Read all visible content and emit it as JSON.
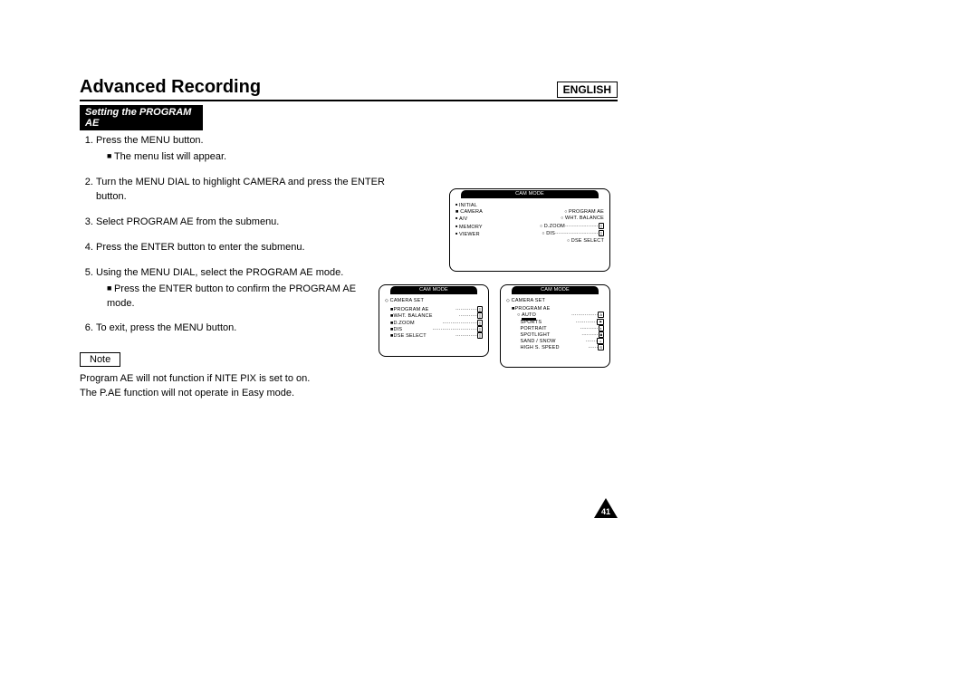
{
  "language": "ENGLISH",
  "title": "Advanced Recording",
  "section": "Setting the PROGRAM AE",
  "steps": [
    {
      "text": "Press the MENU button.",
      "bullets": [
        "The menu list will appear."
      ]
    },
    {
      "text": "Turn the MENU DIAL to highlight CAMERA and press the ENTER button."
    },
    {
      "text": "Select PROGRAM AE from the submenu."
    },
    {
      "text": "Press the ENTER button to enter the submenu."
    },
    {
      "text": "Using the MENU DIAL, select the PROGRAM AE mode.",
      "bullets": [
        "Press the ENTER button to confirm the PROGRAM AE mode."
      ]
    },
    {
      "text": "To exit, press the MENU button."
    }
  ],
  "note_label": "Note",
  "note_lines": [
    "Program AE will not function if NITE PIX is set to on.",
    "The P.AE function will not operate in Easy mode."
  ],
  "page_number": "41",
  "lcd1": {
    "header": "CAM MODE",
    "left": [
      "INITIAL",
      "CAMERA",
      "A/V",
      "MEMORY",
      "VIEWER"
    ],
    "right": [
      "PROGRAM AE",
      "WHT. BALANCE",
      "D.ZOOM",
      "DIS",
      "DSE SELECT"
    ],
    "selected_left": "CAMERA"
  },
  "lcd2": {
    "header": "CAM MODE",
    "group": "CAMERA SET",
    "items": [
      "PROGRAM AE",
      "WHT. BALANCE",
      "D.ZOOM",
      "DIS",
      "DSE SELECT"
    ]
  },
  "lcd3": {
    "header": "CAM MODE",
    "group": "CAMERA SET",
    "subgroup": "PROGRAM AE",
    "items": [
      "AUTO",
      "SPORTS",
      "PORTRAIT",
      "SPOTLIGHT",
      "SAND / SNOW",
      "HIGH S. SPEED"
    ],
    "selected": "AUTO"
  }
}
